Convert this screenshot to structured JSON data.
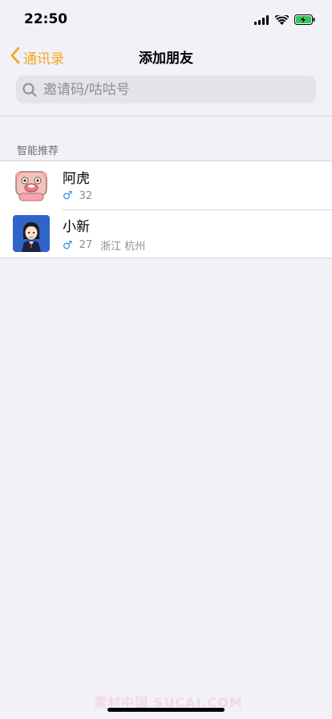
{
  "status_bar": {
    "time": "22:50",
    "signal_icon": "cellular-signal-icon",
    "wifi_icon": "wifi-icon",
    "battery_icon": "battery-charging-icon",
    "battery_color": "#34c759"
  },
  "nav": {
    "back_label": "通讯录",
    "title": "添加朋友",
    "accent_color": "#f4a622"
  },
  "search": {
    "placeholder": "邀请码/咕咕号"
  },
  "section": {
    "title": "智能推荐"
  },
  "friends": [
    {
      "name": "阿虎",
      "gender": "♂",
      "age": "32",
      "location": "",
      "avatar_icon": "pink-cartoon-avatar-icon"
    },
    {
      "name": "小新",
      "gender": "♂",
      "age": "27",
      "location": "浙江 杭州",
      "avatar_icon": "girl-cartoon-avatar-icon"
    }
  ],
  "watermark": "素材中国 SUCAI.COM"
}
